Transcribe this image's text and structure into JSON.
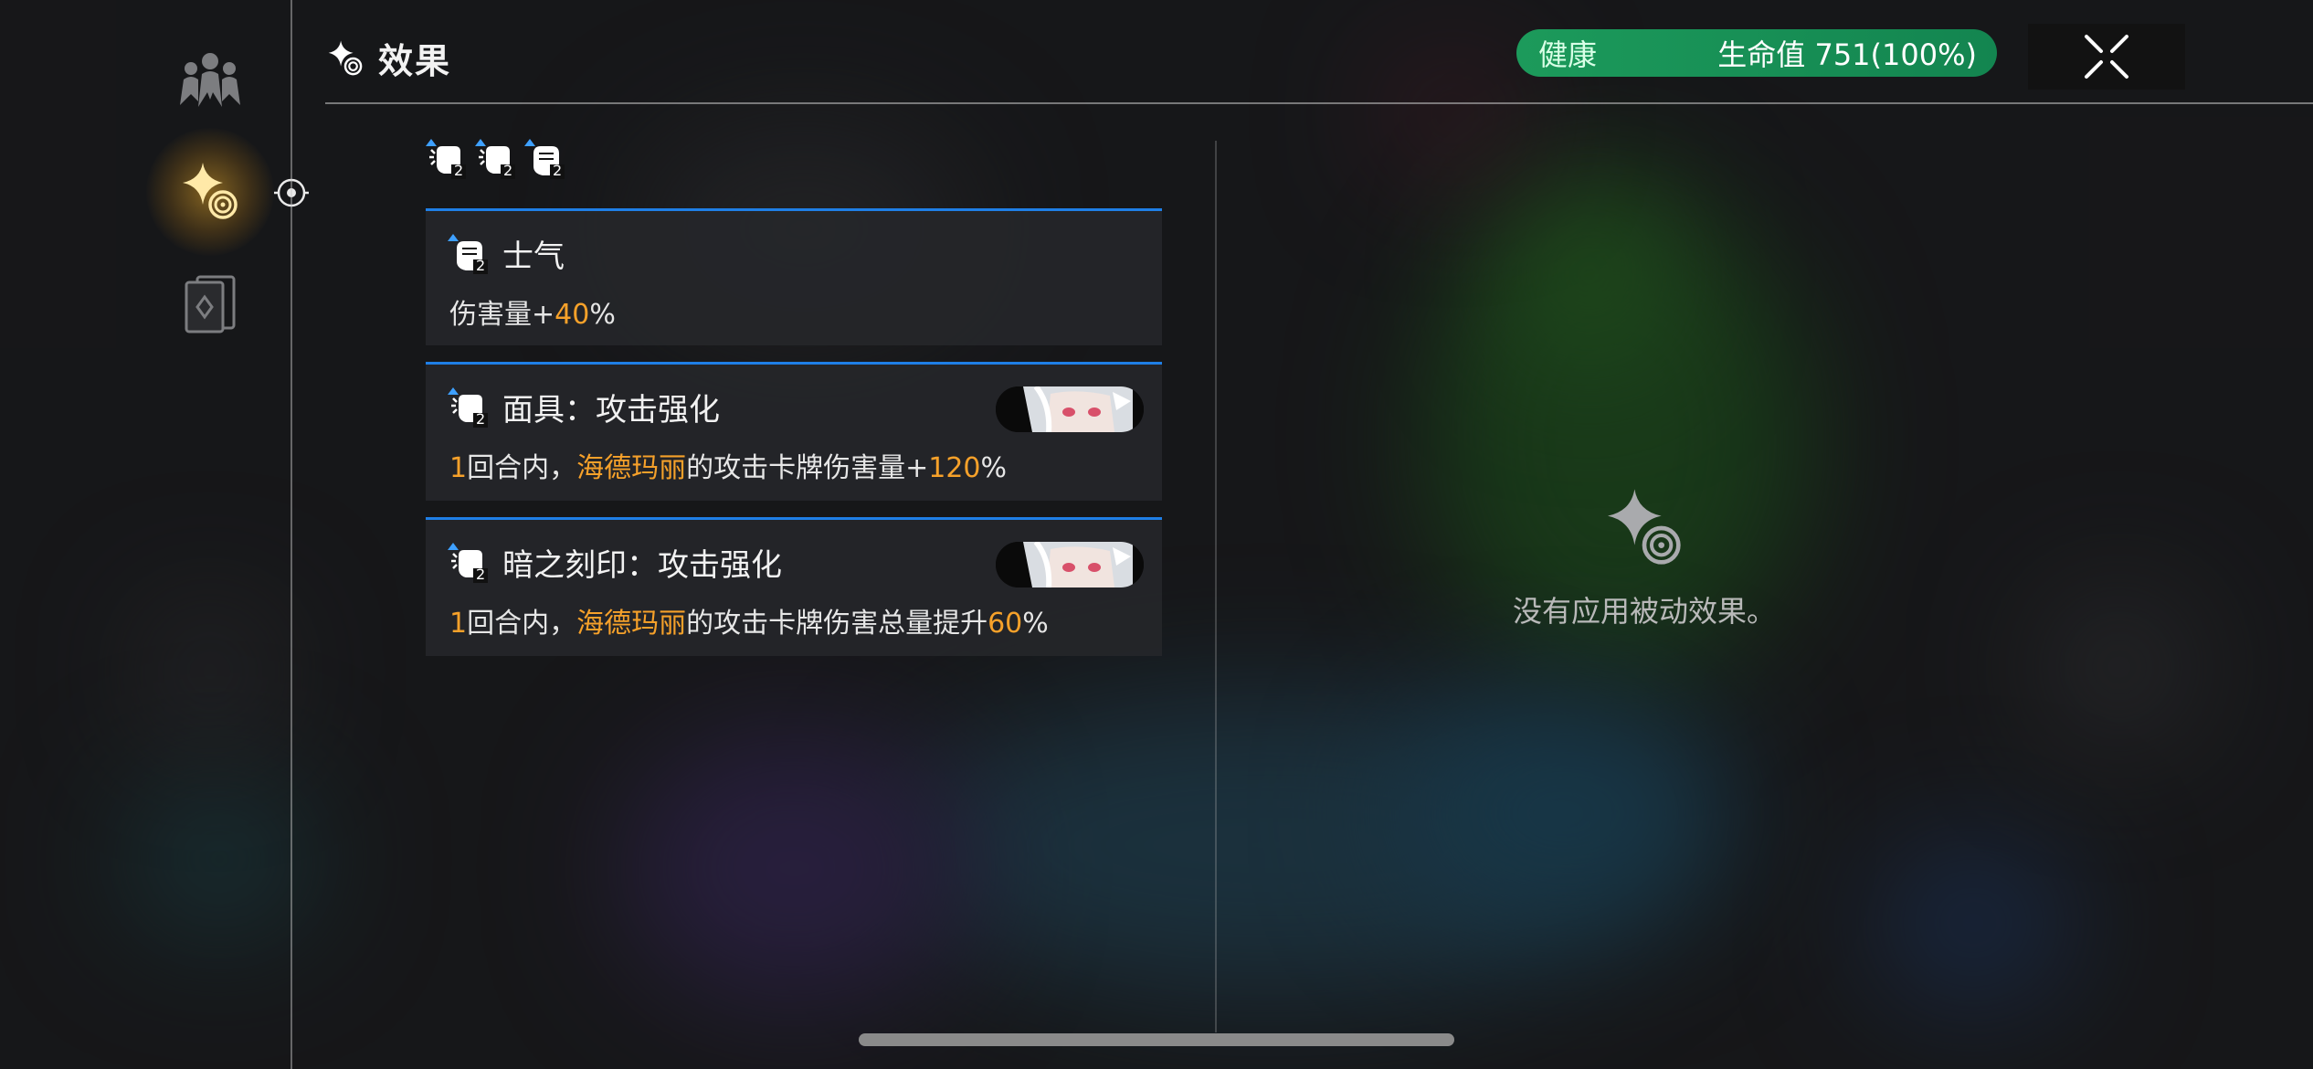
{
  "header": {
    "title": "效果",
    "health_status": "健康",
    "health_value": "生命值 751(100%)"
  },
  "effects": [
    {
      "title": "士气",
      "desc_parts": [
        "伤害量+",
        "40",
        "%"
      ]
    },
    {
      "title": "面具：攻击强化",
      "desc_parts": [
        "1",
        "回合内，",
        "海德玛丽",
        "的攻击卡牌伤害量+",
        "120",
        "%"
      ]
    },
    {
      "title": "暗之刻印：攻击强化",
      "desc_parts": [
        "1",
        "回合内，",
        "海德玛丽",
        "的攻击卡牌伤害总量提升",
        "60",
        "%"
      ]
    }
  ],
  "stack_count": "2",
  "passive": {
    "empty_text": "没有应用被动效果。"
  },
  "colors": {
    "accent_blue": "#1f7fe6",
    "highlight_orange": "#f6a12a",
    "health_green": "#1c9a5b"
  },
  "icons": {
    "rail": [
      "team-icon",
      "effects-sparkle-icon",
      "card-deck-icon"
    ],
    "close": "close-x-icon"
  }
}
